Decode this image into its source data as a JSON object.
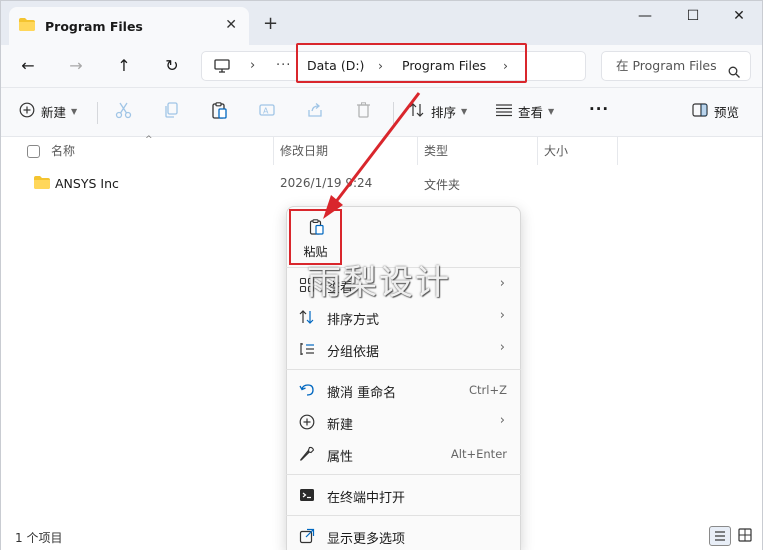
{
  "tab": {
    "title": "Program Files",
    "close": "✕",
    "new": "+"
  },
  "window_controls": {
    "minimize": "—",
    "maximize": "☐",
    "close": "✕"
  },
  "nav": {
    "back": "←",
    "forward": "→",
    "up": "↑",
    "refresh": "↻",
    "more": "···",
    "crumbs": [
      "Data (D:)",
      "Program Files"
    ],
    "sep": "›",
    "search_placeholder": "在 Program Files"
  },
  "toolbar": {
    "new_label": "新建",
    "sort_label": "排序",
    "view_label": "查看",
    "more_label": "···",
    "preview_label": "预览"
  },
  "columns": {
    "name": "名称",
    "date": "修改日期",
    "type": "类型",
    "size": "大小"
  },
  "files": [
    {
      "name": "ANSYS Inc",
      "date": "2026/1/19 9:24",
      "type": "文件夹"
    }
  ],
  "status": {
    "count": "1 个项目"
  },
  "context_menu": {
    "paste_label": "粘贴",
    "items": [
      {
        "label": "查看",
        "key": "",
        "arrow": "›"
      },
      {
        "label": "排序方式",
        "key": "",
        "arrow": "›"
      },
      {
        "label": "分组依据",
        "key": "",
        "arrow": "›"
      },
      {
        "label": "撤消 重命名",
        "key": "Ctrl+Z",
        "arrow": ""
      },
      {
        "label": "新建",
        "key": "",
        "arrow": "›"
      },
      {
        "label": "属性",
        "key": "Alt+Enter",
        "arrow": ""
      },
      {
        "label": "在终端中打开",
        "key": "",
        "arrow": ""
      },
      {
        "label": "显示更多选项",
        "key": "",
        "arrow": ""
      }
    ]
  },
  "watermark": "雨梨设计",
  "colors": {
    "highlight": "#d9262c",
    "folder": "#f4c430",
    "accent": "#0067c0"
  }
}
